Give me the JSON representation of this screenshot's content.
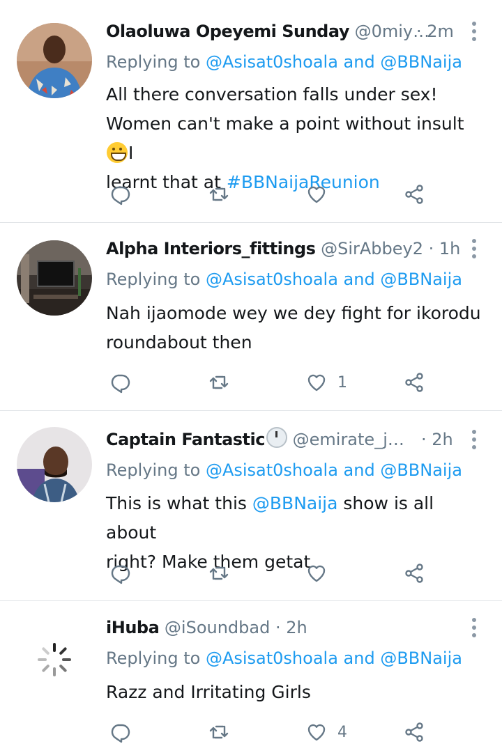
{
  "tweets": [
    {
      "name": "Olaoluwa Opeyemi Sunday",
      "handle": "@0miy…",
      "time": "· 2m",
      "reply_prefix": "Replying to ",
      "reply_to_1": "@Asisat0shoala",
      "reply_and": " and ",
      "reply_to_2": "@BBNaija",
      "text_1": "All there conversation falls under sex!",
      "text_2a": "Women can't make a point without insult ",
      "text_2b": "I",
      "text_3a": "learnt that at ",
      "hashtag": "#BBNaijaReunion",
      "likes": ""
    },
    {
      "name": "Alpha Interiors_fittings",
      "handle": "@SirAbbey2",
      "time": "· 1h",
      "reply_prefix": "Replying to ",
      "reply_to_1": "@Asisat0shoala",
      "reply_and": " and ",
      "reply_to_2": "@BBNaija",
      "text_1": "Nah ijaomode wey we dey fight for ikorodu",
      "text_2": "roundabout then",
      "likes": "1"
    },
    {
      "name": "Captain Fantastic",
      "handle": "@emirate_j…",
      "time": "· 2h",
      "reply_prefix": "Replying to ",
      "reply_to_1": "@Asisat0shoala",
      "reply_and": " and ",
      "reply_to_2": "@BBNaija",
      "text_1a": "This is what this ",
      "text_1_mention": "@BBNaija",
      "text_1b": " show is all about",
      "text_2": "right? Make them getat",
      "likes": ""
    },
    {
      "name": "iHuba",
      "handle": "@iSoundbad",
      "time": "· 2h",
      "reply_prefix": "Replying to ",
      "reply_to_1": "@Asisat0shoala",
      "reply_and": " and ",
      "reply_to_2": "@BBNaija",
      "text_1": "Razz and Irritating Girls",
      "likes": "4"
    }
  ],
  "icons": [
    "reply-icon",
    "retweet-icon",
    "like-icon",
    "share-icon",
    "more-icon",
    "loading-spinner-icon"
  ],
  "colors": {
    "link": "#1d9bf0",
    "muted": "#657786",
    "text": "#14171a",
    "divider": "#dfe3e6"
  }
}
